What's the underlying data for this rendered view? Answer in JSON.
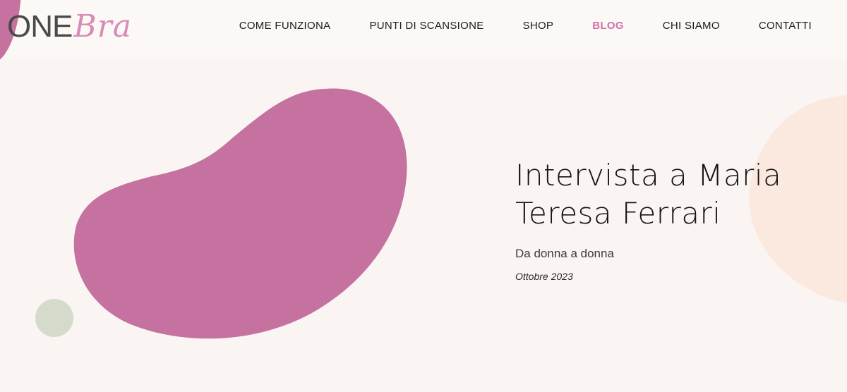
{
  "header": {
    "logo_one": "ONE",
    "logo_bra": "Bra",
    "nav": [
      {
        "label": "COME FUNZIONA",
        "active": false
      },
      {
        "label": "PUNTI DI SCANSIONE",
        "active": false
      },
      {
        "label": "SHOP",
        "active": false
      },
      {
        "label": "BLOG",
        "active": true
      },
      {
        "label": "CHI SIAMO",
        "active": false
      },
      {
        "label": "CONTATTI",
        "active": false
      }
    ]
  },
  "hero": {
    "title_line1": "Intervista a Maria",
    "title_line2": "Teresa Ferrari",
    "subtitle": "Da donna a donna",
    "date": "Ottobre 2023"
  },
  "colors": {
    "background": "#faf5f2",
    "blob_pink": "#c572a0",
    "circle_sage": "#d5dbcb",
    "blob_peach": "#fbe9df",
    "accent": "#d070a8"
  }
}
